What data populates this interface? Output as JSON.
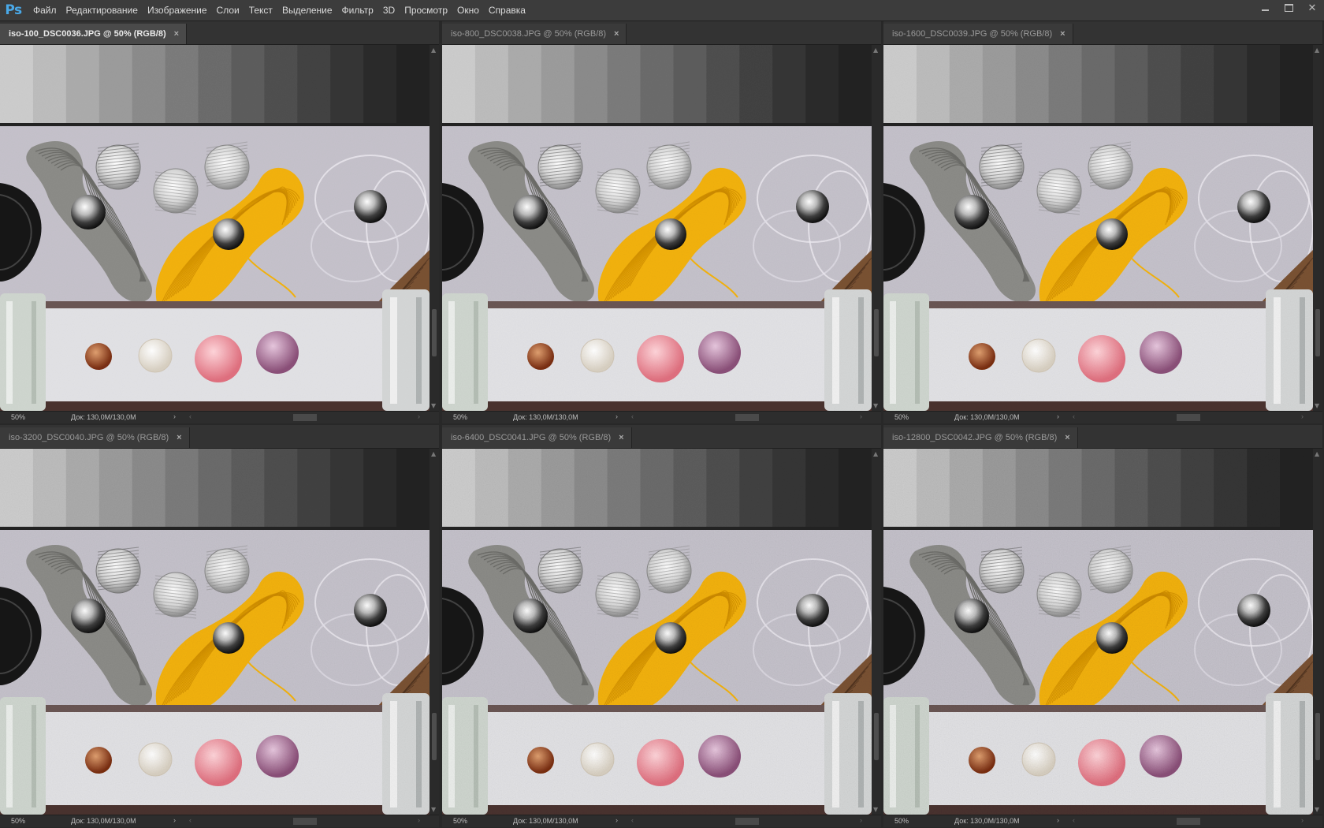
{
  "app": {
    "logo": "Ps",
    "menu": [
      "Файл",
      "Редактирование",
      "Изображение",
      "Слои",
      "Текст",
      "Выделение",
      "Фильтр",
      "3D",
      "Просмотр",
      "Окно",
      "Справка"
    ],
    "window_controls": [
      "minimize-icon",
      "restore-icon",
      "close-icon"
    ]
  },
  "documents": [
    {
      "title": "iso-100_DSC0036.JPG @ 50% (RGB/8)",
      "zoom": "50%",
      "doc_size": "Док: 130,0M/130,0M",
      "active": true
    },
    {
      "title": "iso-800_DSC0038.JPG @ 50% (RGB/8)",
      "zoom": "50%",
      "doc_size": "Док: 130,0M/130,0M",
      "active": false
    },
    {
      "title": "iso-1600_DSC0039.JPG @ 50% (RGB/8)",
      "zoom": "50%",
      "doc_size": "Док: 130,0M/130,0M",
      "active": false
    },
    {
      "title": "iso-3200_DSC0040.JPG @ 50% (RGB/8)",
      "zoom": "50%",
      "doc_size": "Док: 130,0M/130,0M",
      "active": false
    },
    {
      "title": "iso-6400_DSC0041.JPG @ 50% (RGB/8)",
      "zoom": "50%",
      "doc_size": "Док: 130,0M/130,0M",
      "active": false
    },
    {
      "title": "iso-12800_DSC0042.JPG @ 50% (RGB/8)",
      "zoom": "50%",
      "doc_size": "Док: 130,0M/130,0M",
      "active": false
    }
  ],
  "colors": {
    "grayscale_patches": [
      "#cdcdcd",
      "#bdbdbd",
      "#acacac",
      "#9c9c9c",
      "#8c8c8c",
      "#7c7c7c",
      "#6c6c6c",
      "#5d5d5d",
      "#4f4f4f",
      "#424242",
      "#363636",
      "#2b2b2b",
      "#222222"
    ],
    "yellow_thread": "#f3b20e",
    "gray_thread": "#8c8c88"
  }
}
